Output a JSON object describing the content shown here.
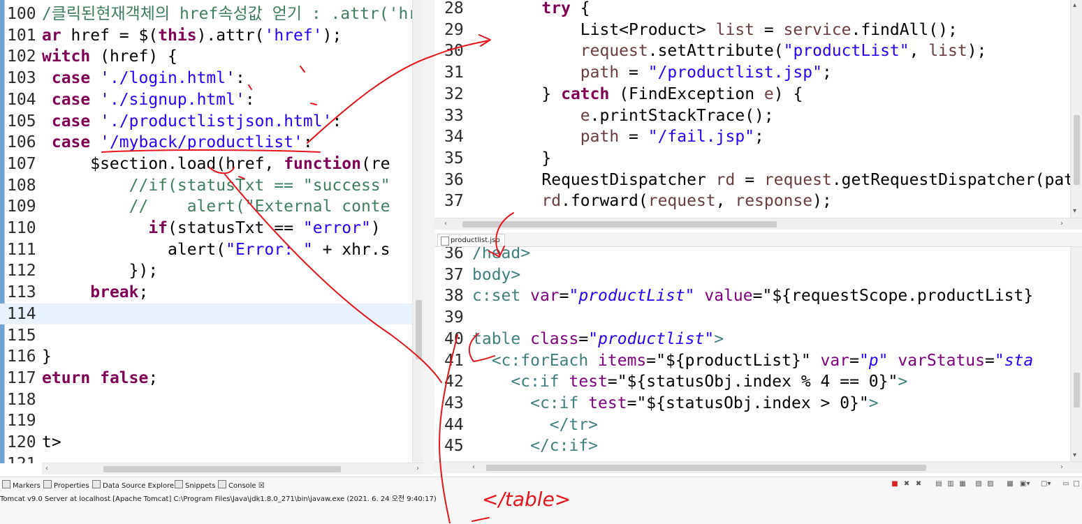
{
  "left_editor": {
    "lines": [
      {
        "num": "100",
        "parts": [
          {
            "c": "cmt",
            "t": "/클릭된현재객체의 href속성값 얻기 : .attr('hr"
          }
        ]
      },
      {
        "num": "101",
        "parts": [
          {
            "c": "kw",
            "t": "ar"
          },
          {
            "c": "",
            "t": " href = $("
          },
          {
            "c": "kw",
            "t": "this"
          },
          {
            "c": "",
            "t": ").attr("
          },
          {
            "c": "str",
            "t": "'href'"
          },
          {
            "c": "",
            "t": ");"
          }
        ]
      },
      {
        "num": "102",
        "parts": [
          {
            "c": "kw",
            "t": "witch"
          },
          {
            "c": "",
            "t": " (href) {"
          }
        ]
      },
      {
        "num": "103",
        "parts": [
          {
            "c": "",
            "t": " "
          },
          {
            "c": "kw",
            "t": "case"
          },
          {
            "c": "",
            "t": " "
          },
          {
            "c": "str",
            "t": "'./login.html'"
          },
          {
            "c": "",
            "t": ":"
          }
        ]
      },
      {
        "num": "104",
        "parts": [
          {
            "c": "",
            "t": " "
          },
          {
            "c": "kw",
            "t": "case"
          },
          {
            "c": "",
            "t": " "
          },
          {
            "c": "str",
            "t": "'./signup.html'"
          },
          {
            "c": "",
            "t": ":"
          }
        ]
      },
      {
        "num": "105",
        "parts": [
          {
            "c": "",
            "t": " "
          },
          {
            "c": "kw",
            "t": "case"
          },
          {
            "c": "",
            "t": " "
          },
          {
            "c": "str",
            "t": "'./productlistjson.html'"
          },
          {
            "c": "",
            "t": ":"
          }
        ]
      },
      {
        "num": "106",
        "parts": [
          {
            "c": "",
            "t": " "
          },
          {
            "c": "kw",
            "t": "case"
          },
          {
            "c": "",
            "t": " "
          },
          {
            "c": "str",
            "t": "'/myback/productlist'"
          },
          {
            "c": "",
            "t": ":"
          }
        ]
      },
      {
        "num": "107",
        "parts": [
          {
            "c": "",
            "t": "     $section.load(href, "
          },
          {
            "c": "kw",
            "t": "function"
          },
          {
            "c": "",
            "t": "(re"
          }
        ]
      },
      {
        "num": "108",
        "parts": [
          {
            "c": "cmt",
            "t": "         //if(statusTxt == \"success\""
          }
        ]
      },
      {
        "num": "109",
        "parts": [
          {
            "c": "cmt",
            "t": "         //    alert(\"External conte"
          }
        ]
      },
      {
        "num": "110",
        "parts": [
          {
            "c": "",
            "t": "           "
          },
          {
            "c": "kw",
            "t": "if"
          },
          {
            "c": "",
            "t": "(statusTxt == "
          },
          {
            "c": "str",
            "t": "\"error\""
          },
          {
            "c": "",
            "t": ")"
          }
        ]
      },
      {
        "num": "111",
        "parts": [
          {
            "c": "",
            "t": "             alert("
          },
          {
            "c": "str",
            "t": "\"Error: \""
          },
          {
            "c": "",
            "t": " + xhr.s"
          }
        ]
      },
      {
        "num": "112",
        "parts": [
          {
            "c": "",
            "t": "         });"
          }
        ]
      },
      {
        "num": "113",
        "parts": [
          {
            "c": "",
            "t": "     "
          },
          {
            "c": "kw",
            "t": "break"
          },
          {
            "c": "",
            "t": ";"
          }
        ]
      },
      {
        "num": "114",
        "parts": [
          {
            "c": "",
            "t": ""
          }
        ]
      },
      {
        "num": "115",
        "parts": [
          {
            "c": "",
            "t": ""
          }
        ]
      },
      {
        "num": "116",
        "parts": [
          {
            "c": "",
            "t": "}"
          }
        ]
      },
      {
        "num": "117",
        "parts": [
          {
            "c": "kw",
            "t": "eturn"
          },
          {
            "c": "",
            "t": " "
          },
          {
            "c": "kw",
            "t": "false"
          },
          {
            "c": "",
            "t": ";"
          }
        ]
      },
      {
        "num": "118",
        "parts": [
          {
            "c": "",
            "t": ""
          }
        ]
      },
      {
        "num": "119",
        "parts": [
          {
            "c": "",
            "t": ""
          }
        ]
      },
      {
        "num": "120",
        "parts": [
          {
            "c": "",
            "t": "t>"
          }
        ]
      },
      {
        "num": "121",
        "parts": [
          {
            "c": "",
            "t": ""
          }
        ]
      }
    ],
    "highlight_line": "114"
  },
  "java_editor": {
    "lines": [
      {
        "num": "28",
        "parts": [
          {
            "c": "",
            "t": "    "
          },
          {
            "c": "kw",
            "t": "try"
          },
          {
            "c": "",
            "t": " {"
          }
        ]
      },
      {
        "num": "29",
        "parts": [
          {
            "c": "",
            "t": "        List<Product> "
          },
          {
            "c": "var",
            "t": "list"
          },
          {
            "c": "",
            "t": " = "
          },
          {
            "c": "var",
            "t": "service"
          },
          {
            "c": "",
            "t": ".findAll();"
          }
        ]
      },
      {
        "num": "30",
        "parts": [
          {
            "c": "",
            "t": "        "
          },
          {
            "c": "var",
            "t": "request"
          },
          {
            "c": "",
            "t": ".setAttribute("
          },
          {
            "c": "str",
            "t": "\"productList\""
          },
          {
            "c": "",
            "t": ", "
          },
          {
            "c": "var",
            "t": "list"
          },
          {
            "c": "",
            "t": ");"
          }
        ]
      },
      {
        "num": "31",
        "parts": [
          {
            "c": "",
            "t": "        "
          },
          {
            "c": "var",
            "t": "path"
          },
          {
            "c": "",
            "t": " = "
          },
          {
            "c": "str",
            "t": "\"/productlist.jsp\""
          },
          {
            "c": "",
            "t": ";"
          }
        ]
      },
      {
        "num": "32",
        "parts": [
          {
            "c": "",
            "t": "    } "
          },
          {
            "c": "kw",
            "t": "catch"
          },
          {
            "c": "",
            "t": " (FindException "
          },
          {
            "c": "var",
            "t": "e"
          },
          {
            "c": "",
            "t": ") {"
          }
        ]
      },
      {
        "num": "33",
        "parts": [
          {
            "c": "",
            "t": "        "
          },
          {
            "c": "var",
            "t": "e"
          },
          {
            "c": "",
            "t": ".printStackTrace();"
          }
        ]
      },
      {
        "num": "34",
        "parts": [
          {
            "c": "",
            "t": "        "
          },
          {
            "c": "var",
            "t": "path"
          },
          {
            "c": "",
            "t": " = "
          },
          {
            "c": "str",
            "t": "\"/fail.jsp\""
          },
          {
            "c": "",
            "t": ";"
          }
        ]
      },
      {
        "num": "35",
        "parts": [
          {
            "c": "",
            "t": "    }"
          }
        ]
      },
      {
        "num": "36",
        "parts": [
          {
            "c": "",
            "t": "    RequestDispatcher "
          },
          {
            "c": "var",
            "t": "rd"
          },
          {
            "c": "",
            "t": " = "
          },
          {
            "c": "var",
            "t": "request"
          },
          {
            "c": "",
            "t": ".getRequestDispatcher(pat"
          }
        ]
      },
      {
        "num": "37",
        "parts": [
          {
            "c": "",
            "t": "    "
          },
          {
            "c": "var",
            "t": "rd"
          },
          {
            "c": "",
            "t": ".forward("
          },
          {
            "c": "var",
            "t": "request"
          },
          {
            "c": "",
            "t": ", "
          },
          {
            "c": "var",
            "t": "response"
          },
          {
            "c": "",
            "t": ");"
          }
        ]
      }
    ]
  },
  "jsp_tab": {
    "label": "productlist.jsp"
  },
  "jsp_editor": {
    "lines": [
      {
        "num": "36",
        "parts": [
          {
            "c": "tag",
            "t": "/head>"
          }
        ]
      },
      {
        "num": "37",
        "parts": [
          {
            "c": "tag",
            "t": "body>"
          }
        ]
      },
      {
        "num": "38",
        "parts": [
          {
            "c": "tag",
            "t": "c:set"
          },
          {
            "c": "",
            "t": " "
          },
          {
            "c": "attr",
            "t": "var"
          },
          {
            "c": "",
            "t": "="
          },
          {
            "c": "attrval",
            "t": "\"productList\""
          },
          {
            "c": "",
            "t": " "
          },
          {
            "c": "attr",
            "t": "value"
          },
          {
            "c": "",
            "t": "=\"${requestScope.productList}"
          }
        ]
      },
      {
        "num": "39",
        "parts": [
          {
            "c": "",
            "t": ""
          }
        ]
      },
      {
        "num": "40",
        "parts": [
          {
            "c": "tag",
            "t": "table"
          },
          {
            "c": "",
            "t": " "
          },
          {
            "c": "attr",
            "t": "class"
          },
          {
            "c": "",
            "t": "="
          },
          {
            "c": "attrval",
            "t": "\"productlist\""
          },
          {
            "c": "tag",
            "t": ">"
          }
        ]
      },
      {
        "num": "41",
        "parts": [
          {
            "c": "",
            "t": "  "
          },
          {
            "c": "tag",
            "t": "<c:forEach"
          },
          {
            "c": "",
            "t": " "
          },
          {
            "c": "attr",
            "t": "items"
          },
          {
            "c": "",
            "t": "=\"${productList}\" "
          },
          {
            "c": "attr",
            "t": "var"
          },
          {
            "c": "",
            "t": "="
          },
          {
            "c": "attrval",
            "t": "\"p\""
          },
          {
            "c": "",
            "t": " "
          },
          {
            "c": "attr",
            "t": "varStatus"
          },
          {
            "c": "",
            "t": "="
          },
          {
            "c": "attrval",
            "t": "\"sta"
          }
        ]
      },
      {
        "num": "42",
        "parts": [
          {
            "c": "",
            "t": "    "
          },
          {
            "c": "tag",
            "t": "<c:if"
          },
          {
            "c": "",
            "t": " "
          },
          {
            "c": "attr",
            "t": "test"
          },
          {
            "c": "",
            "t": "=\"${statusObj.index % 4 == 0}\""
          },
          {
            "c": "tag",
            "t": ">"
          }
        ]
      },
      {
        "num": "43",
        "parts": [
          {
            "c": "",
            "t": "      "
          },
          {
            "c": "tag",
            "t": "<c:if"
          },
          {
            "c": "",
            "t": " "
          },
          {
            "c": "attr",
            "t": "test"
          },
          {
            "c": "",
            "t": "=\"${statusObj.index > 0}\""
          },
          {
            "c": "tag",
            "t": ">"
          }
        ]
      },
      {
        "num": "44",
        "parts": [
          {
            "c": "",
            "t": "        "
          },
          {
            "c": "tag",
            "t": "</tr>"
          }
        ]
      },
      {
        "num": "45",
        "parts": [
          {
            "c": "",
            "t": "      "
          },
          {
            "c": "tag",
            "t": "</c:if>"
          }
        ]
      }
    ]
  },
  "bottom_views": {
    "tabs": [
      "Markers",
      "Properties",
      "Data Source Explorer",
      "Snippets",
      "Console"
    ],
    "console_close": "☒",
    "status": "Tomcat v9.0 Server at localhost [Apache Tomcat] C:\\Program Files\\Java\\jdk1.8.0_271\\bin\\javaw.exe  (2021. 6. 24 오전 9:40:17)"
  },
  "handwriting": {
    "note": "</table>"
  },
  "colors": {
    "ink": "#e8141b",
    "keyword": "#7f0055",
    "string": "#2a00ff",
    "comment": "#3f7f5f"
  }
}
